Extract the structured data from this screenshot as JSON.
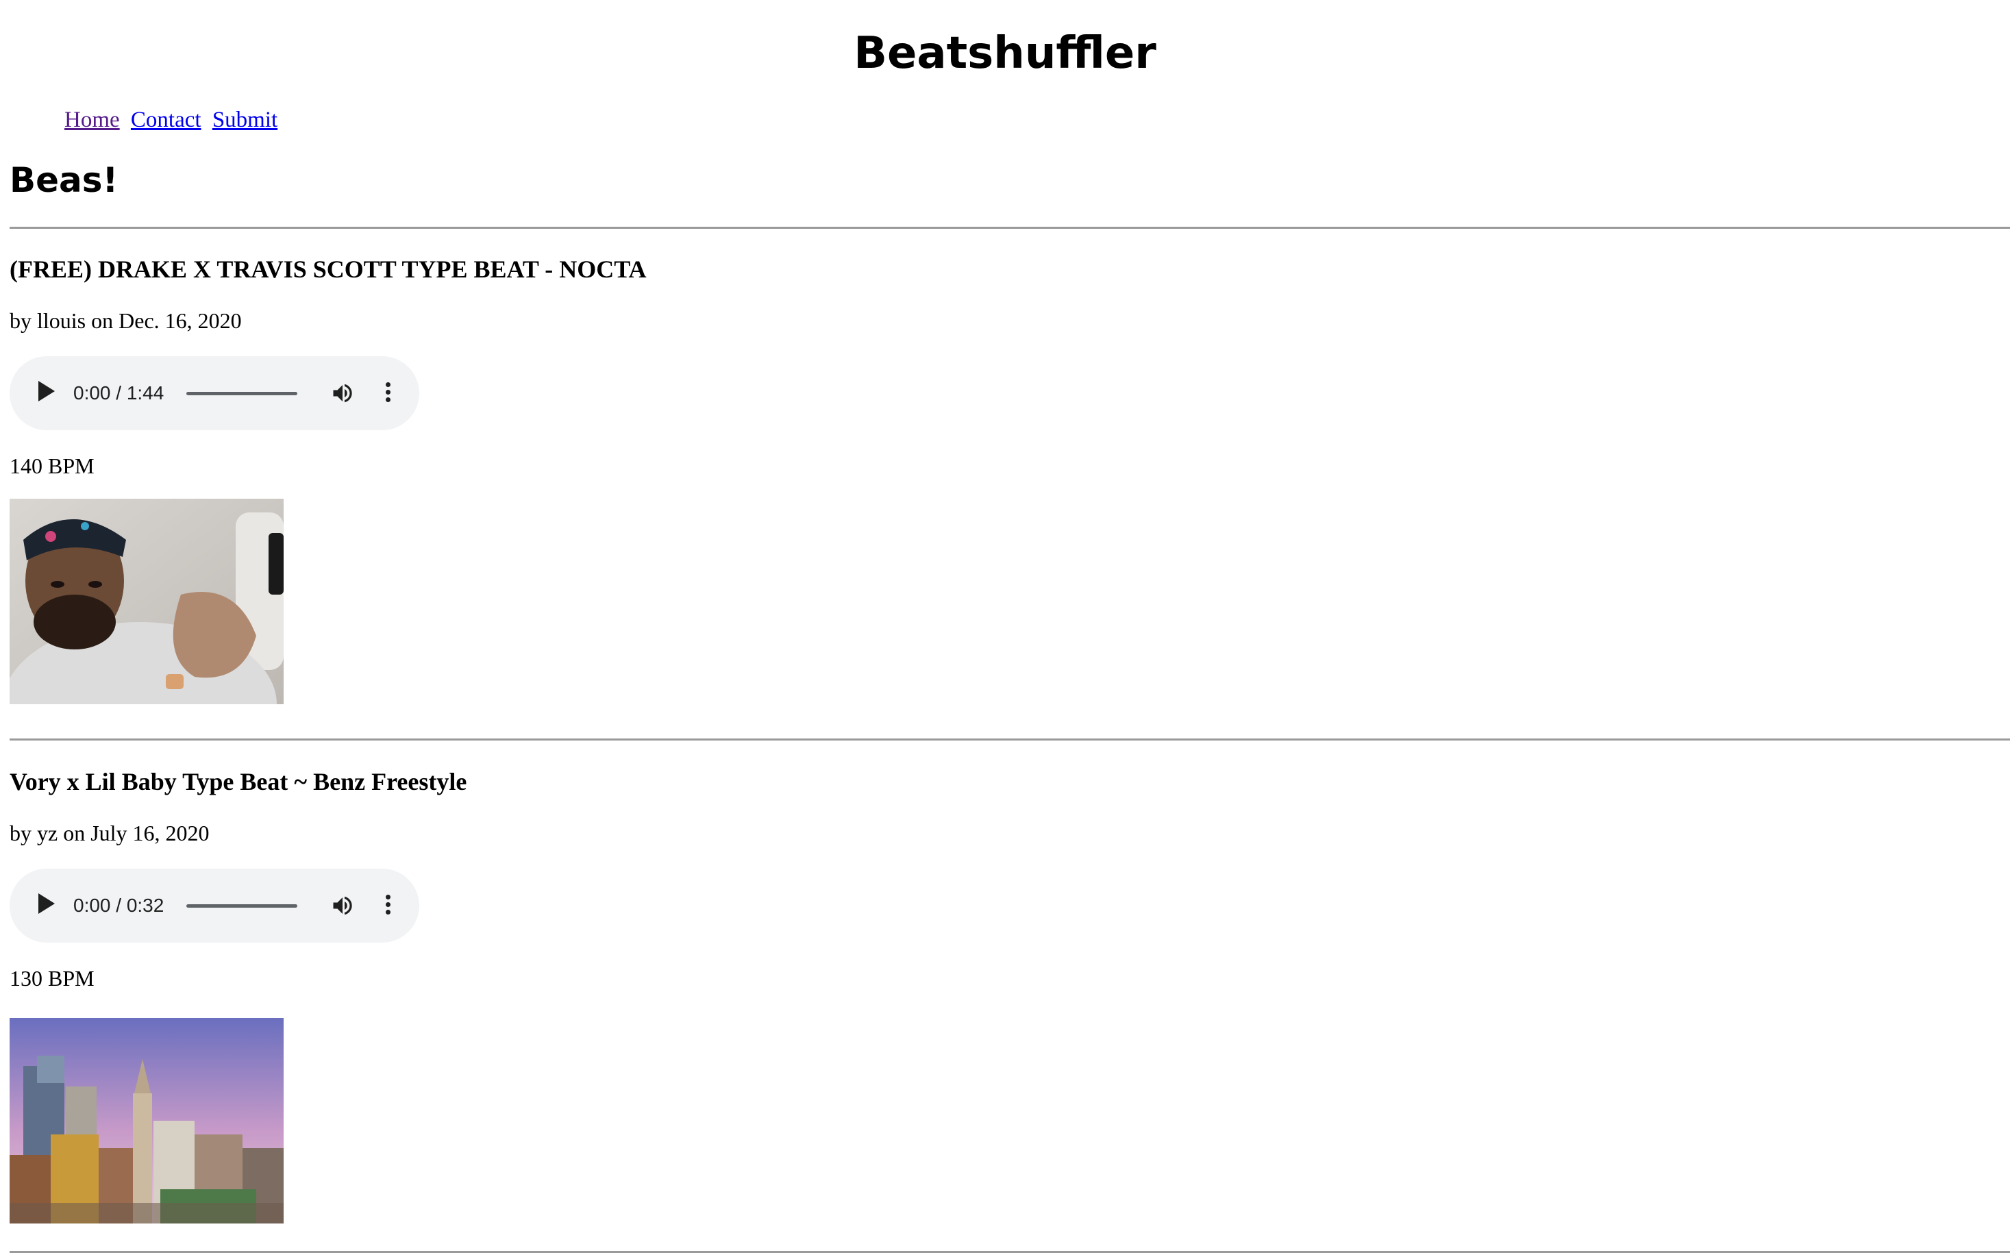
{
  "site": {
    "title": "Beatshuffler"
  },
  "nav": {
    "items": [
      {
        "label": "Home",
        "state": "visited"
      },
      {
        "label": "Contact",
        "state": "link"
      },
      {
        "label": "Submit",
        "state": "link"
      }
    ]
  },
  "section": {
    "title": "Beas!"
  },
  "posts": [
    {
      "title": "(FREE) DRAKE X TRAVIS SCOTT TYPE BEAT - NOCTA",
      "meta": "by llouis on Dec. 16, 2020",
      "player": {
        "time": "0:00 / 1:44",
        "play_icon": "play-icon",
        "volume_icon": "volume-icon",
        "more_icon": "more-vertical-icon"
      },
      "bpm": "140 BPM",
      "image": "man-in-cap-photo"
    },
    {
      "title": "Vory x Lil Baby Type Beat ~ Benz Freestyle",
      "meta": "by yz on July 16, 2020",
      "player": {
        "time": "0:00 / 0:32",
        "play_icon": "play-icon",
        "volume_icon": "volume-icon",
        "more_icon": "more-vertical-icon"
      },
      "bpm": "130 BPM",
      "image": "city-skyline-photo"
    }
  ]
}
